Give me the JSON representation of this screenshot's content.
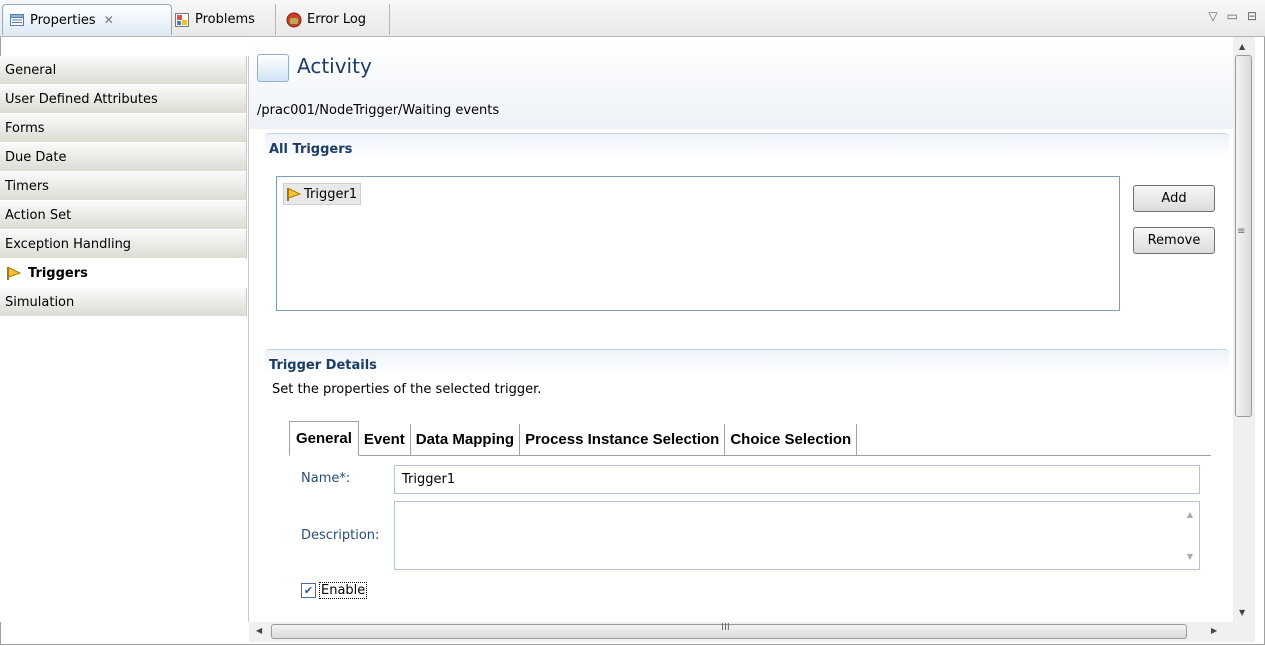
{
  "view_tabs": [
    {
      "label": "Properties",
      "icon": "properties-icon",
      "active": true,
      "close": "✕"
    },
    {
      "label": "Problems",
      "icon": "problems-icon",
      "active": false
    },
    {
      "label": "Error Log",
      "icon": "error-log-icon",
      "active": false
    }
  ],
  "window_controls": {
    "menu": "▽",
    "minimize": "▭",
    "maximize": "⊟"
  },
  "sidebar": {
    "items": [
      {
        "label": "General"
      },
      {
        "label": "User Defined Attributes"
      },
      {
        "label": "Forms"
      },
      {
        "label": "Due Date"
      },
      {
        "label": "Timers"
      },
      {
        "label": "Action Set"
      },
      {
        "label": "Exception Handling"
      },
      {
        "label": "Triggers",
        "selected": true,
        "icon": "trigger-flag-icon"
      },
      {
        "label": "Simulation"
      }
    ]
  },
  "header": {
    "title": "Activity",
    "path": "/prac001/NodeTrigger/Waiting events"
  },
  "all_triggers": {
    "heading": "All Triggers",
    "items": [
      "Trigger1"
    ],
    "add_label": "Add",
    "remove_label": "Remove"
  },
  "trigger_details": {
    "heading": "Trigger Details",
    "description": "Set the properties of the selected trigger.",
    "tabs": [
      "General",
      "Event",
      "Data Mapping",
      "Process Instance Selection",
      "Choice Selection"
    ],
    "name_label": "Name*:",
    "name_value": "Trigger1",
    "description_label": "Description:",
    "description_value": "",
    "enable_label": "Enable",
    "enable_checked": true
  },
  "scrollbar": {
    "grip": "≡",
    "hgrip": "III"
  },
  "colors": {
    "accent": "#1d3d66",
    "flag": "#e8a400"
  }
}
